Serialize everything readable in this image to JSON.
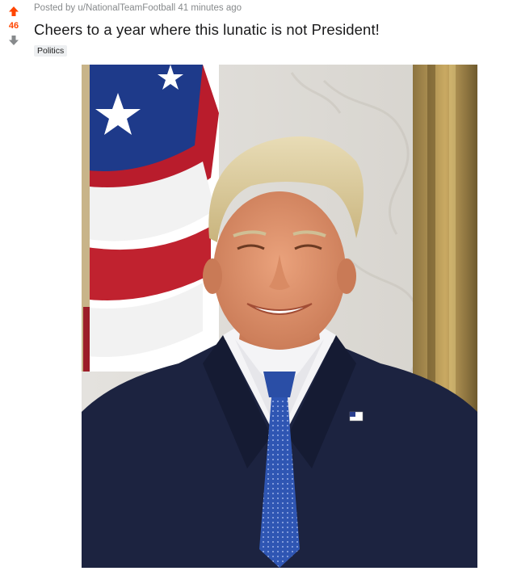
{
  "post": {
    "score": "46",
    "posted_by_prefix": "Posted by",
    "author": "u/NationalTeamFootball",
    "time_ago": "41 minutes ago",
    "title": "Cheers to a year where this lunatic is not President!",
    "flair": "Politics"
  },
  "colors": {
    "upvote": "#ff4500",
    "downvote": "#878a8c",
    "meta_text": "#878a8c",
    "title_text": "#1a1a1b",
    "flair_bg": "#edeff1"
  },
  "icons": {
    "upvote": "arrow-up-icon",
    "downvote": "arrow-down-icon"
  }
}
